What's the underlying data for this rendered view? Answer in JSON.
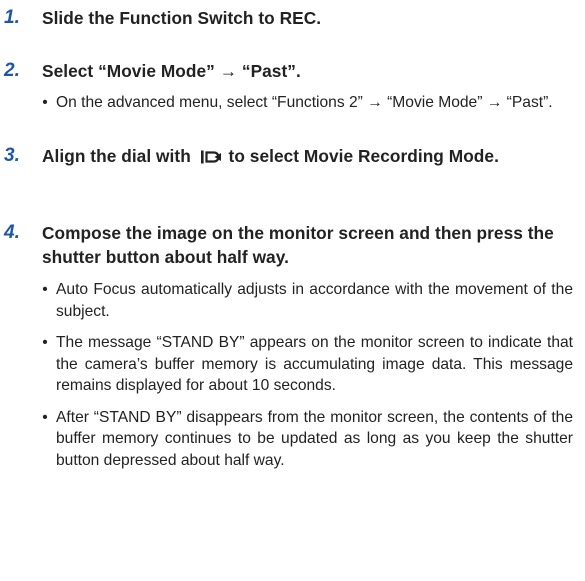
{
  "steps": [
    {
      "number": "1.",
      "text": "Slide the Function Switch to REC.",
      "bullets": []
    },
    {
      "number": "2.",
      "text": "Select “Movie Mode” → “Past”.",
      "bullets": [
        "On the advanced menu, select “Functions 2” → “Movie Mode” → “Past”."
      ]
    },
    {
      "number": "3.",
      "text_before_icon": "Align the dial with",
      "icon": "movie-camera-icon",
      "text_after_icon": "to select Movie Recording Mode.",
      "bullets": []
    },
    {
      "number": "4.",
      "text": "Compose the image on the monitor screen and then press the shutter button about half way.",
      "bullets": [
        "Auto Focus automatically adjusts in accordance with the movement of the subject.",
        "The message “STAND BY” appears on the monitor screen to indicate that the camera’s buffer memory is accumulating image data. This message remains displayed for about 10 seconds.",
        "After “STAND BY” disappears from the monitor screen, the contents of the buffer memory continues to be updated as long as you keep the shutter button depressed about half way."
      ]
    }
  ],
  "bullet_symbol": "•",
  "colors": {
    "step_number": "#1f56a8",
    "text": "#222222"
  }
}
